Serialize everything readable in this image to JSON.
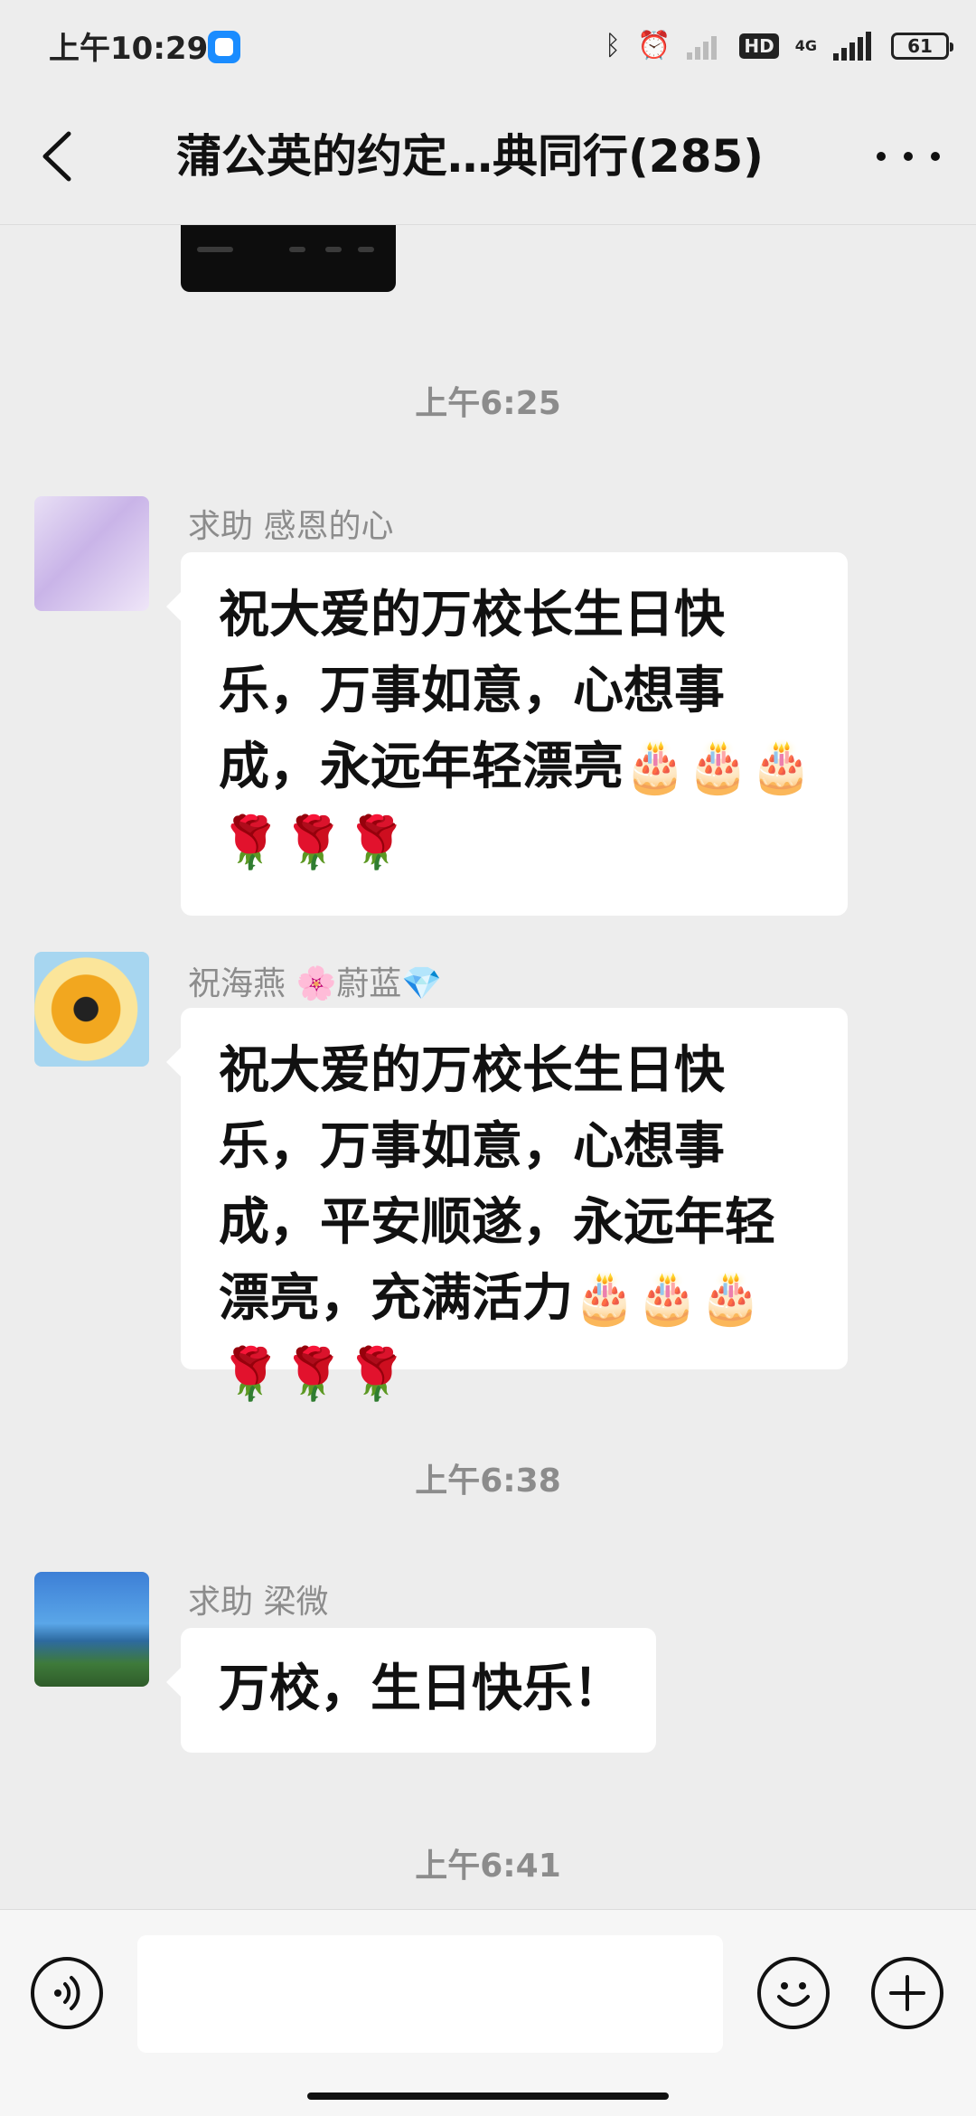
{
  "status_bar": {
    "time": "上午10:29",
    "network_label": "4G",
    "hd_label": "HD",
    "battery": "61"
  },
  "header": {
    "title": "蒲公英的约定…典同行(285)"
  },
  "messages": [
    {
      "timestamp": "上午6:25",
      "sender": "求助 感恩的心",
      "text": "祝大爱的万校长生日快乐，万事如意，心想事成，永远年轻漂亮🎂🎂🎂🌹🌹🌹"
    },
    {
      "sender": "祝海燕 🌸蔚蓝💎",
      "text": "祝大爱的万校长生日快乐，万事如意，心想事成，平安顺遂，永远年轻漂亮，充满活力🎂🎂🎂🌹🌹🌹"
    },
    {
      "timestamp": "上午6:38",
      "sender": "求助  梁微",
      "text": "万校，生日快乐！"
    },
    {
      "timestamp": "上午6:41"
    }
  ],
  "input_bar": {
    "value": "",
    "placeholder": ""
  }
}
